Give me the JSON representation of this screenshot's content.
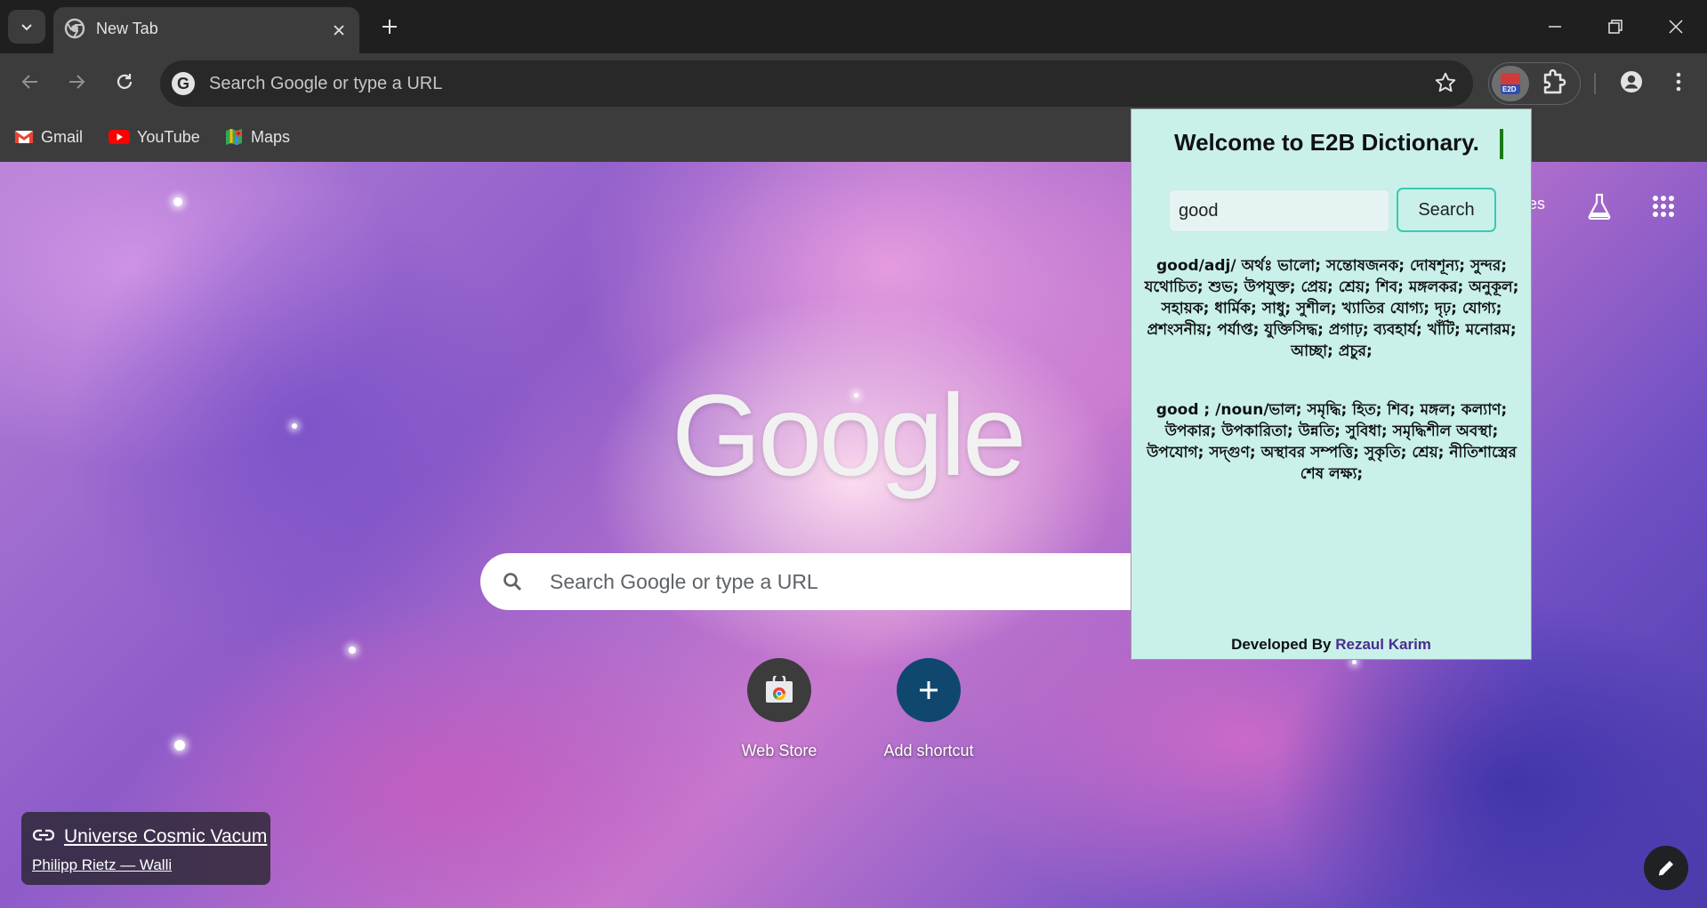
{
  "browser": {
    "tab": {
      "title": "New Tab",
      "favicon": "chrome-icon"
    },
    "address_bar": {
      "placeholder": "Search Google or type a URL"
    },
    "bookmarks": [
      {
        "label": "Gmail",
        "icon": "gmail-icon"
      },
      {
        "label": "YouTube",
        "icon": "youtube-icon"
      },
      {
        "label": "Maps",
        "icon": "maps-icon"
      }
    ],
    "extension_badge": "E2D"
  },
  "ntp": {
    "logo": "Google",
    "search_placeholder": "Search Google or type a URL",
    "partial_link": "es",
    "shortcuts": [
      {
        "label": "Web Store",
        "icon": "webstore-icon"
      },
      {
        "label": "Add shortcut",
        "icon": "plus-icon"
      }
    ],
    "attribution": {
      "title": "Universe Cosmic Vacum",
      "author": "Philipp Rietz — Walli"
    }
  },
  "popup": {
    "title": "Welcome to E2B Dictionary.",
    "input_value": "good",
    "search_label": "Search",
    "definition_1": "good/adj/ অর্থঃ  ভালো; সন্তোষজনক; দোষশূন্য; সুন্দর; যথোচিত; শুভ; উপযুক্ত; প্রেয়; শ্রেয়; শিব; মঙ্গলকর; অনুকূল; সহায়ক; ধার্মিক; সাধু; সুশীল; খ্যাতির যোগ্য; দৃঢ়; যোগ্য; প্রশংসনীয়; পর্যাপ্ত; যুক্তিসিদ্ধ; প্রগাঢ়; ব্যবহার্য; খাঁটি; মনোরম; আচ্ছা; প্রচুর;",
    "definition_2": "good ; /noun/ভাল; সমৃদ্ধি; হিত; শিব; মঙ্গল; কল্যাণ; উপকার; উপকারিতা; উন্নতি; সুবিধা; সমৃদ্ধিশীল অবস্থা; উপযোগ; সদ্গুণ; অস্থাবর সম্পত্তি; সুকৃতি; শ্রেয়; নীতিশাস্ত্রের শেষ লক্ষ্য;",
    "footer_prefix": "Developed By ",
    "footer_author": "Rezaul Karim"
  }
}
